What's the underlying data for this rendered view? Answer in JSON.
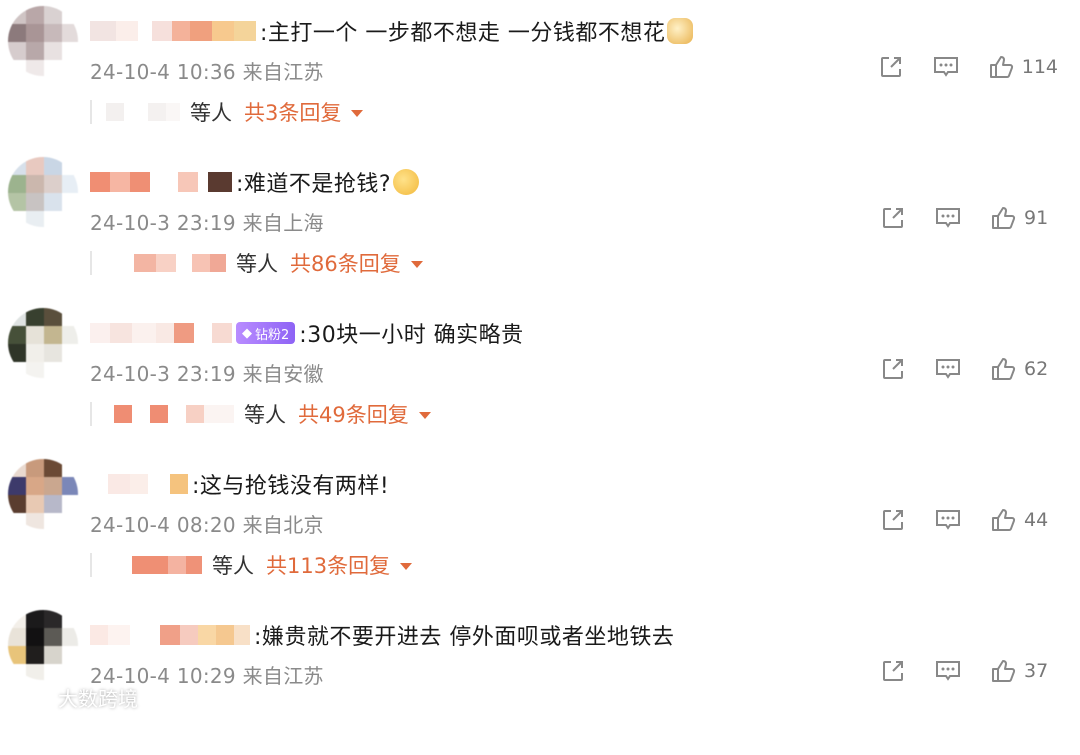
{
  "comments": [
    {
      "text": ":主打一个 一步都不想走 一分钱都不想花",
      "meta": "24-10-4 10:36 来自江苏",
      "likes": "114",
      "deng": "等人",
      "reply_more": "共3条回复"
    },
    {
      "text": ":难道不是抢钱?",
      "meta": "24-10-3 23:19 来自上海",
      "likes": "91",
      "deng": "等人",
      "reply_more": "共86条回复"
    },
    {
      "text": ":30块一小时 确实略贵",
      "badge": "钻粉2",
      "meta": "24-10-3 23:19 来自安徽",
      "likes": "62",
      "deng": "等人",
      "reply_more": "共49条回复"
    },
    {
      "text": ":这与抢钱没有两样!",
      "meta": "24-10-4 08:20 来自北京",
      "likes": "44",
      "deng": "等人",
      "reply_more": "共113条回复"
    },
    {
      "text": ":嫌贵就不要开进去 停外面呗或者坐地铁去",
      "meta": "24-10-4 10:29 来自江苏",
      "likes": "37"
    }
  ],
  "watermark": {
    "text": "大数跨境"
  },
  "icons": {
    "share": "share-icon",
    "comment": "comment-icon",
    "like": "like-icon",
    "expand": "caret-down-icon"
  },
  "colors": {
    "accent": "#e06a3b",
    "meta": "#8a8a8a",
    "badge": "#9b6cf7"
  }
}
